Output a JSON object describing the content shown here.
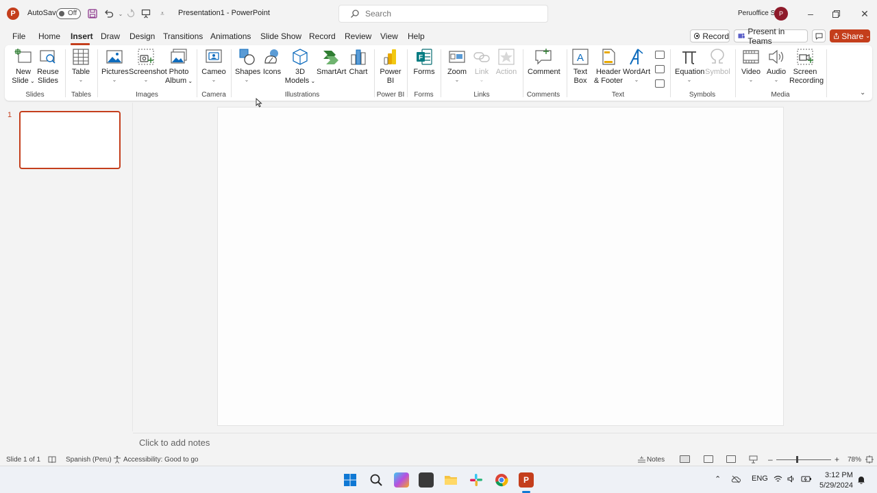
{
  "titlebar": {
    "autosave_label": "AutoSave",
    "autosave_state": "Off",
    "doc_title": "Presentation1  -  PowerPoint",
    "search_placeholder": "Search",
    "user_name": "Peruoffice S",
    "avatar_initial": "P"
  },
  "tabs": [
    "File",
    "Home",
    "Insert",
    "Draw",
    "Design",
    "Transitions",
    "Animations",
    "Slide Show",
    "Record",
    "Review",
    "View",
    "Help"
  ],
  "active_tab": "Insert",
  "actions": {
    "record": "Record",
    "present_in_teams": "Present in Teams",
    "share": "Share"
  },
  "ribbon": {
    "slides": {
      "new_slide_1": "New",
      "new_slide_2": "Slide",
      "reuse_1": "Reuse",
      "reuse_2": "Slides",
      "label": "Slides"
    },
    "tables": {
      "table": "Table",
      "label": "Tables"
    },
    "images": {
      "pictures": "Pictures",
      "screenshot": "Screenshot",
      "photo_album_1": "Photo",
      "photo_album_2": "Album",
      "label": "Images"
    },
    "camera": {
      "cameo": "Cameo",
      "label": "Camera"
    },
    "illustrations": {
      "shapes": "Shapes",
      "icons": "Icons",
      "models_1": "3D",
      "models_2": "Models",
      "smartart": "SmartArt",
      "chart": "Chart",
      "label": "Illustrations"
    },
    "powerbi": {
      "powerbi_1": "Power",
      "powerbi_2": "BI",
      "label": "Power BI"
    },
    "forms": {
      "forms": "Forms",
      "label": "Forms"
    },
    "links": {
      "zoom": "Zoom",
      "link": "Link",
      "action": "Action",
      "label": "Links"
    },
    "comments": {
      "comment": "Comment",
      "label": "Comments"
    },
    "text": {
      "textbox_1": "Text",
      "textbox_2": "Box",
      "header_1": "Header",
      "header_2": "& Footer",
      "wordart": "WordArt",
      "label": "Text"
    },
    "symbols": {
      "equation": "Equation",
      "symbol": "Symbol",
      "label": "Symbols"
    },
    "media": {
      "video": "Video",
      "audio": "Audio",
      "screen_rec_1": "Screen",
      "screen_rec_2": "Recording",
      "label": "Media"
    }
  },
  "thumbnail": {
    "number": "1"
  },
  "notes_placeholder": "Click to add notes",
  "statusbar": {
    "slide_info": "Slide 1 of 1",
    "language": "Spanish (Peru)",
    "accessibility": "Accessibility: Good to go",
    "notes": "Notes",
    "zoom_level": "78%"
  },
  "taskbar": {
    "language": "ENG",
    "time": "3:12 PM",
    "date": "5/29/2024"
  },
  "colors": {
    "accent": "#c43e1c",
    "ribbon_bg": "#ffffff",
    "app_bg": "#f3f3f3"
  }
}
